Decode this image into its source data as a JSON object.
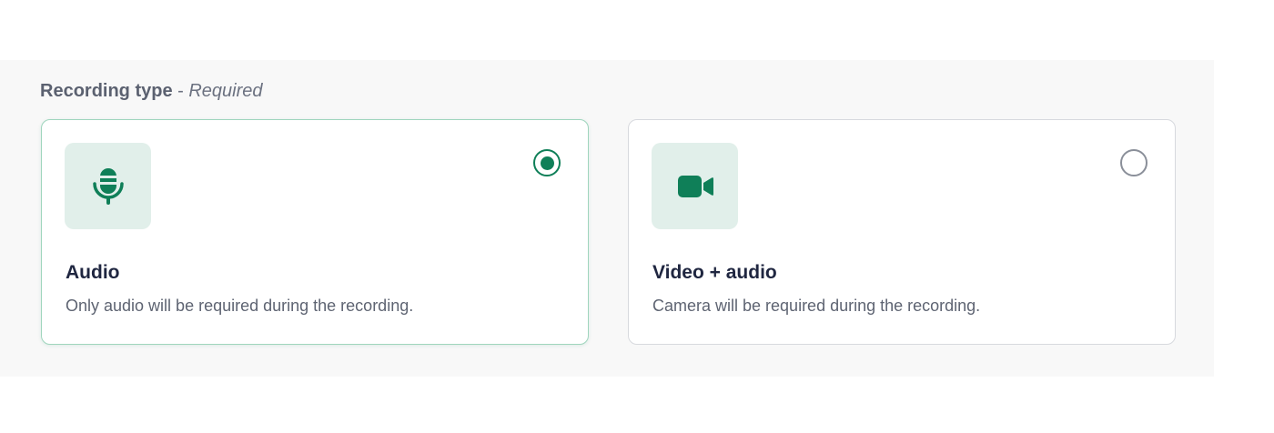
{
  "recording_type": {
    "label": "Recording type",
    "separator": " - ",
    "required_text": "Required",
    "options": [
      {
        "title": "Audio",
        "description": "Only audio will be required during the recording.",
        "icon": "microphone-icon",
        "selected": true
      },
      {
        "title": "Video + audio",
        "description": "Camera will be required during the recording.",
        "icon": "video-camera-icon",
        "selected": false
      }
    ]
  },
  "colors": {
    "accent": "#0f7f58",
    "icon_tile_bg": "#e1efea",
    "selected_border": "#9fd5bd",
    "panel_bg": "#f8f8f8"
  }
}
